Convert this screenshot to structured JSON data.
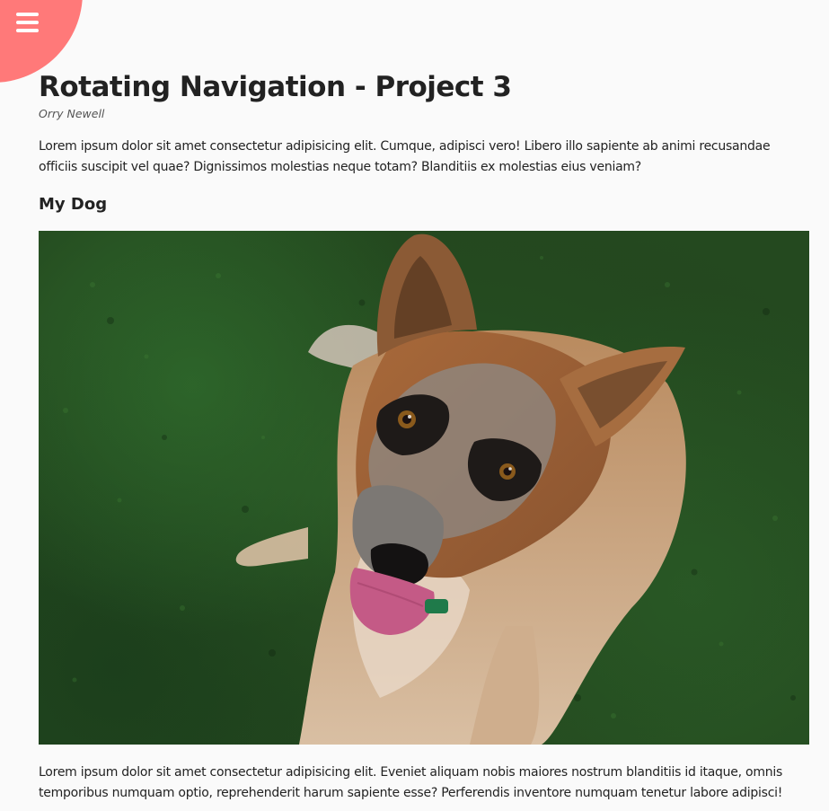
{
  "nav": {
    "menu_icon": "hamburger-menu-icon",
    "accent_color": "#ff7979"
  },
  "article": {
    "title": "Rotating Navigation - Project 3",
    "author": "Orry Newell",
    "intro": "Lorem ipsum dolor sit amet consectetur adipisicing elit. Cumque, adipisci vero! Libero illo sapiente ab animi recusandae officiis suscipit vel quae? Dignissimos molestias neque totam? Blanditiis ex molestias eius veniam?",
    "subheading": "My Dog",
    "image": "dog-on-grass-photo",
    "outro": "Lorem ipsum dolor sit amet consectetur adipisicing elit. Eveniet aliquam nobis maiores nostrum blanditiis id itaque, omnis temporibus numquam optio, reprehenderit harum sapiente esse? Perferendis inventore numquam tenetur labore adipisci!"
  }
}
